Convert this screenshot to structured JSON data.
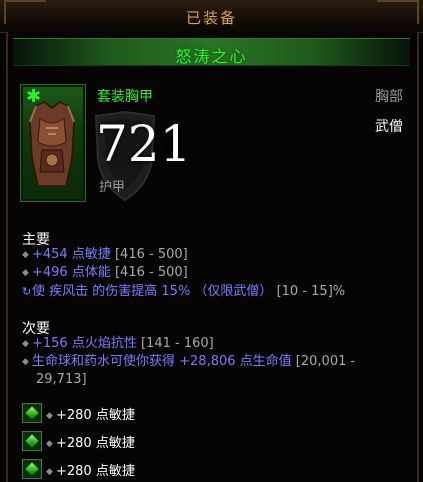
{
  "header": {
    "equipped_label": "已装备"
  },
  "item": {
    "name": "怒涛之心",
    "type": "套装胸甲",
    "slot": "胸部",
    "class": "武僧",
    "armor": "721",
    "armor_label": "护甲"
  },
  "primary": {
    "title": "主要",
    "stats": [
      {
        "value": "+454 点敏捷",
        "range": "[416 - 500]"
      },
      {
        "value": "+496 点体能",
        "range": "[416 - 500]"
      },
      {
        "value": "使 疾风击 的伤害提高 15% （仅限武僧）",
        "range": "[10 - 15]%"
      }
    ]
  },
  "secondary": {
    "title": "次要",
    "stats": [
      {
        "value": "+156 点火焰抗性",
        "range": "[141 - 160]"
      },
      {
        "value": "生命球和药水可使你获得 +28,806 点生命值",
        "range": "[20,001 -",
        "range_cont": "29,713]"
      }
    ]
  },
  "sockets": [
    {
      "text": "+280 点敏捷"
    },
    {
      "text": "+280 点敏捷"
    },
    {
      "text": "+280 点敏捷"
    }
  ],
  "colors": {
    "set_green": "#2ff22a",
    "magic_blue": "#7b7bff",
    "gold": "#d9a441"
  }
}
